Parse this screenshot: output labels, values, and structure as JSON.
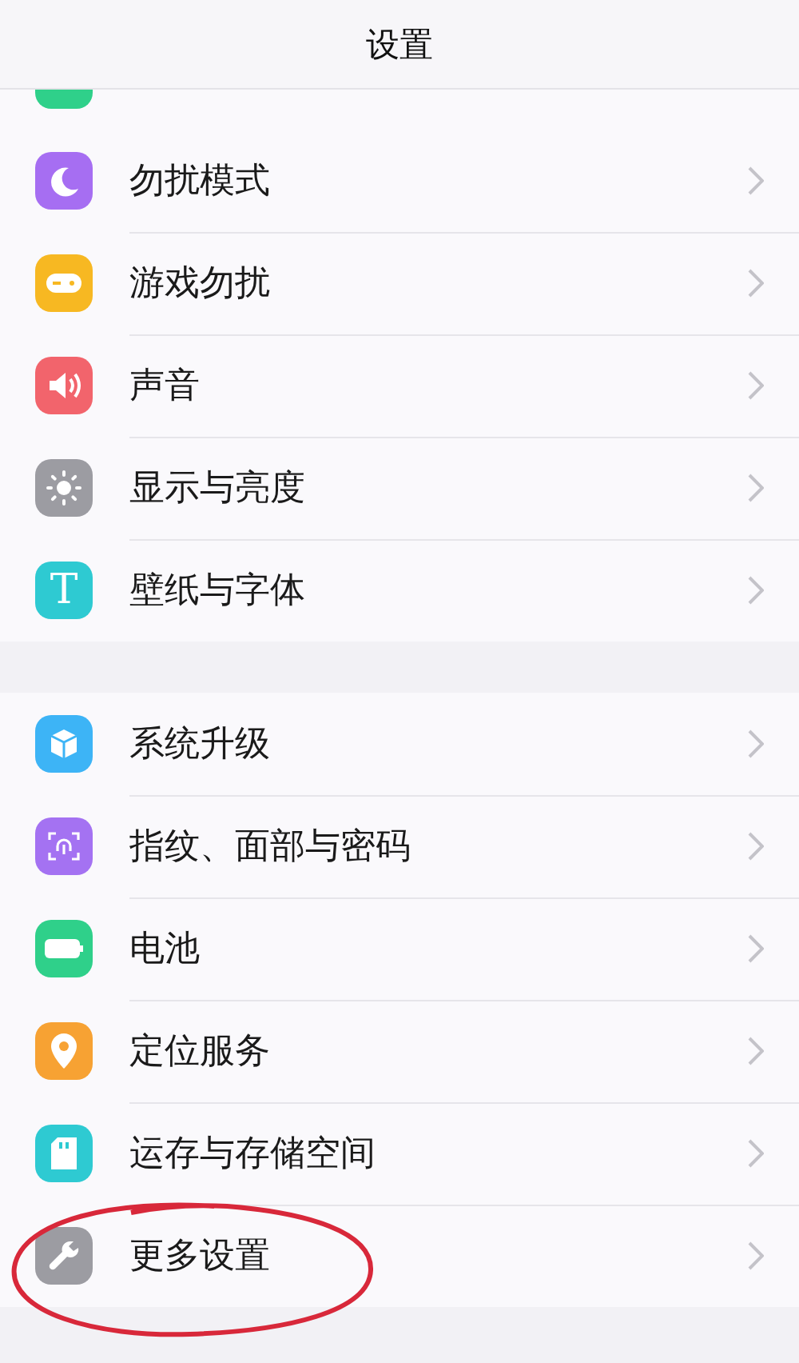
{
  "header": {
    "title": "设置"
  },
  "partial_row": {
    "color": "#2fd08a"
  },
  "groups": [
    {
      "items": [
        {
          "label": "勿扰模式",
          "kind": "moon",
          "color": "#a66ef2"
        },
        {
          "label": "游戏勿扰",
          "kind": "gamepad",
          "color": "#f7b822"
        },
        {
          "label": "声音",
          "kind": "speaker",
          "color": "#f2646c"
        },
        {
          "label": "显示与亮度",
          "kind": "sun",
          "color": "#9c9ca2"
        },
        {
          "label": "壁纸与字体",
          "kind": "glyph",
          "glyph": "T",
          "color": "#2ecad2"
        }
      ]
    },
    {
      "items": [
        {
          "label": "系统升级",
          "kind": "cube",
          "color": "#3db4f6"
        },
        {
          "label": "指纹、面部与密码",
          "kind": "fingerprint",
          "color": "#a472f2"
        },
        {
          "label": "电池",
          "kind": "battery",
          "color": "#2fd08a"
        },
        {
          "label": "定位服务",
          "kind": "pin",
          "color": "#f7a233"
        },
        {
          "label": "运存与存储空间",
          "kind": "card",
          "color": "#2ecad2"
        },
        {
          "label": "更多设置",
          "kind": "wrench",
          "color": "#9c9ca2"
        }
      ]
    }
  ]
}
